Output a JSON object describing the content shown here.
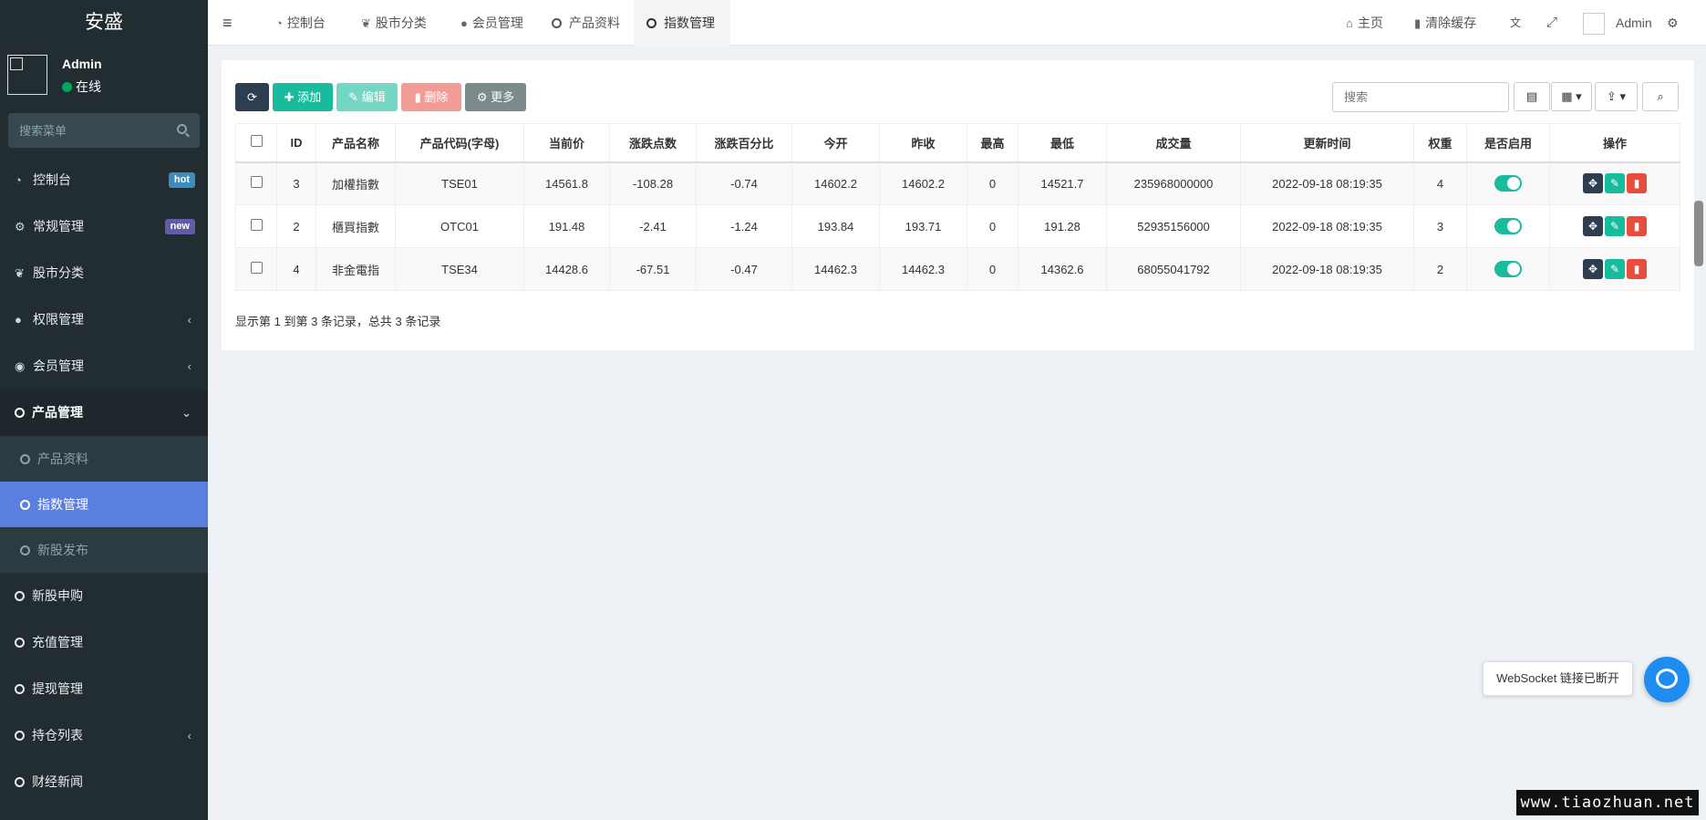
{
  "brand": "安盛",
  "user": {
    "name": "Admin",
    "status": "在线"
  },
  "sidebar": {
    "search_placeholder": "搜索菜单",
    "items": [
      {
        "label": "控制台",
        "icon": "dashboard-icon",
        "badge": "hot"
      },
      {
        "label": "常规管理",
        "icon": "cogs-icon",
        "badge": "new"
      },
      {
        "label": "股市分类",
        "icon": "leaf-icon"
      },
      {
        "label": "权限管理",
        "icon": "group-icon",
        "arrow": "‹"
      },
      {
        "label": "会员管理",
        "icon": "user-circle-icon",
        "arrow": "‹"
      },
      {
        "label": "产品管理",
        "icon": "circle-icon",
        "arrow": "⌄"
      }
    ],
    "sub_items": [
      {
        "label": "产品资料"
      },
      {
        "label": "指数管理"
      },
      {
        "label": "新股发布"
      }
    ],
    "items_after": [
      {
        "label": "新股申购"
      },
      {
        "label": "充值管理"
      },
      {
        "label": "提现管理"
      },
      {
        "label": "持仓列表",
        "arrow": "‹"
      },
      {
        "label": "财经新闻"
      }
    ]
  },
  "topbar": {
    "tabs": [
      {
        "label": "控制台",
        "icon": "dashboard-icon"
      },
      {
        "label": "股市分类",
        "icon": "leaf-icon"
      },
      {
        "label": "会员管理",
        "icon": "user-icon"
      },
      {
        "label": "产品资料",
        "icon": "circle-icon"
      },
      {
        "label": "指数管理",
        "icon": "circle-icon"
      }
    ],
    "home": "主页",
    "clear_cache": "清除缓存",
    "admin": "Admin"
  },
  "toolbar": {
    "add": "添加",
    "edit": "编辑",
    "delete": "删除",
    "more": "更多",
    "search_placeholder": "搜索"
  },
  "table": {
    "headers": [
      "ID",
      "产品名称",
      "产品代码(字母)",
      "当前价",
      "涨跌点数",
      "涨跌百分比",
      "今开",
      "昨收",
      "最高",
      "最低",
      "成交量",
      "更新时间",
      "权重",
      "是否启用",
      "操作"
    ],
    "rows": [
      [
        "3",
        "加權指數",
        "TSE01",
        "14561.8",
        "-108.28",
        "-0.74",
        "14602.2",
        "14602.2",
        "0",
        "14521.7",
        "235968000000",
        "2022-09-18 08:19:35",
        "4"
      ],
      [
        "2",
        "櫃買指數",
        "OTC01",
        "191.48",
        "-2.41",
        "-1.24",
        "193.84",
        "193.71",
        "0",
        "191.28",
        "52935156000",
        "2022-09-18 08:19:35",
        "3"
      ],
      [
        "4",
        "非金電指",
        "TSE34",
        "14428.6",
        "-67.51",
        "-0.47",
        "14462.3",
        "14462.3",
        "0",
        "14362.6",
        "68055041792",
        "2022-09-18 08:19:35",
        "2"
      ]
    ]
  },
  "pagination_info": "显示第 1 到第 3 条记录，总共 3 条记录",
  "websocket_status": "WebSocket 链接已断开",
  "watermark": "www.tiaozhuan.net",
  "colors": {
    "sidebar": "#222d32",
    "active": "#5b7ee1",
    "success": "#18bc9c",
    "danger": "#e74c3c",
    "primary": "#2c3e50"
  }
}
